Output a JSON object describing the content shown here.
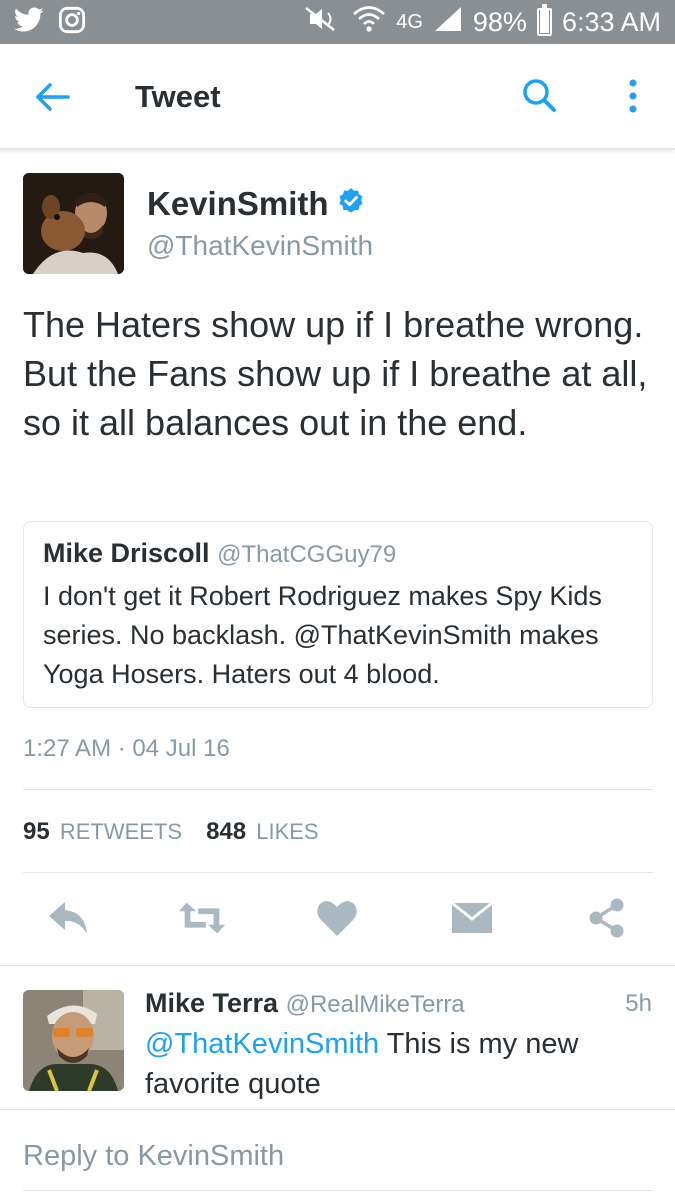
{
  "status_bar": {
    "network": "4G",
    "battery": "98%",
    "battery_level": 0.98,
    "time": "6:33 AM",
    "left_icons": [
      "twitter-bird-icon",
      "instagram-icon"
    ],
    "right_icons": [
      "mute-icon",
      "wifi-icon",
      "signal-icon",
      "battery-icon"
    ]
  },
  "app_bar": {
    "title": "Tweet",
    "icons": [
      "back-arrow-icon",
      "search-icon",
      "more-vertical-icon"
    ],
    "accent_color": "#1da1f2"
  },
  "tweet": {
    "author_name": "KevinSmith",
    "author_handle": "@ThatKevinSmith",
    "verified": true,
    "text": "The Haters show up if I breathe wrong. But the Fans show up if I breathe at all, so it all balances out in the end.",
    "timestamp": "1:27 AM · 04 Jul 16",
    "quoted": {
      "author_name": "Mike Driscoll",
      "author_handle": "@ThatCGGuy79",
      "text": "I don't get it Robert Rodriguez makes Spy Kids series. No backlash. @ThatKevinSmith makes Yoga Hosers. Haters out 4 blood."
    },
    "stats": {
      "retweets_count": "95",
      "retweets_label": "RETWEETS",
      "likes_count": "848",
      "likes_label": "LIKES"
    },
    "actions": [
      "reply-icon",
      "retweet-icon",
      "like-heart-icon",
      "direct-message-icon",
      "share-icon"
    ]
  },
  "reply": {
    "author_name": "Mike Terra",
    "author_handle": "@RealMikeTerra",
    "time": "5h",
    "mention": "@ThatKevinSmith",
    "text": " This is my new favorite quote"
  },
  "compose": {
    "placeholder": "Reply to KevinSmith"
  },
  "colors": {
    "text_primary": "#292f33",
    "text_secondary": "#8899a6",
    "link": "#1da1f2",
    "verified": "#1da1f2",
    "action_icons": "#aab8c2",
    "status_bar": "#8a8f94",
    "divider": "#e1e8ed"
  }
}
